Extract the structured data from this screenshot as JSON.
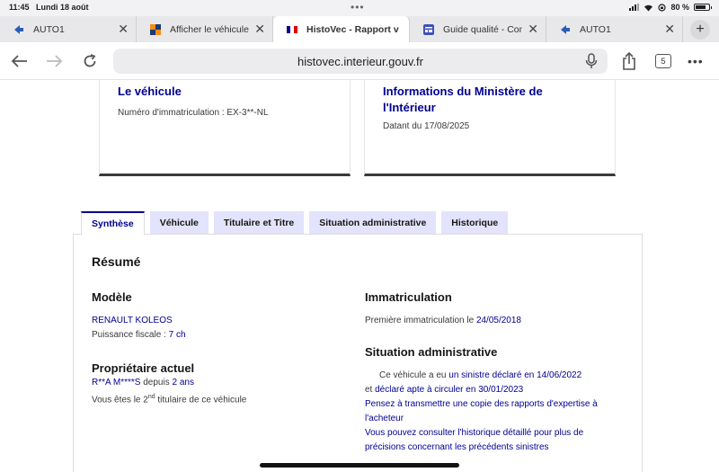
{
  "status_bar": {
    "time": "11:45",
    "date": "Lundi 18 août",
    "battery": "80 %"
  },
  "tabs": [
    {
      "title": "AUTO1",
      "favicon": "auto1-favicon",
      "active": false
    },
    {
      "title": "Afficher le véhicule",
      "favicon": "orange-square-favicon",
      "active": false
    },
    {
      "title": "HistoVec - Rapport v",
      "favicon": "french-flag-favicon",
      "active": true
    },
    {
      "title": "Guide qualité - Com",
      "favicon": "doc-favicon",
      "active": false
    },
    {
      "title": "AUTO1",
      "favicon": "auto1-favicon",
      "active": false
    }
  ],
  "toolbar": {
    "url": "histovec.interieur.gouv.fr",
    "tab_count": "5"
  },
  "cards": {
    "vehicle": {
      "title": "Le véhicule",
      "subtitle": "Numéro d'immatriculation : EX-3**-NL"
    },
    "ministry": {
      "title_line1": "Informations du Ministère de",
      "title_line2": "l'Intérieur",
      "subtitle": "Datant du 17/08/2025"
    }
  },
  "page_tabs": [
    "Synthèse",
    "Véhicule",
    "Titulaire et Titre",
    "Situation administrative",
    "Historique"
  ],
  "summary": {
    "title": "Résumé",
    "model": {
      "heading": "Modèle",
      "name": "RENAULT KOLEOS",
      "power_label": "Puissance fiscale : ",
      "power_value": "7 ch"
    },
    "owner": {
      "heading": "Propriétaire actuel",
      "name": "R**A M****S",
      "since_label": " depuis ",
      "since_value": "2 ans",
      "you_are_prefix": "Vous êtes le 2",
      "you_are_sup": "nd",
      "you_are_suffix": " titulaire de ce véhicule"
    },
    "registration": {
      "heading": "Immatriculation",
      "label": "Première immatriculation le ",
      "date": "24/05/2018"
    },
    "admin": {
      "heading": "Situation administrative",
      "line1_prefix": "Ce véhicule a eu ",
      "line1_link": "un sinistre déclaré en 14/06/2022",
      "line2_prefix": "et ",
      "line2_link": "déclaré apte à circuler en 30/01/2023",
      "note1_line1": "Pensez à transmettre une copie des rapports d'expertise à",
      "note1_line2": "l'acheteur",
      "note2_line1": "Vous pouvez consulter l'historique détaillé pour plus de",
      "note2_line2": "précisions concernant les précédents sinistres"
    }
  }
}
